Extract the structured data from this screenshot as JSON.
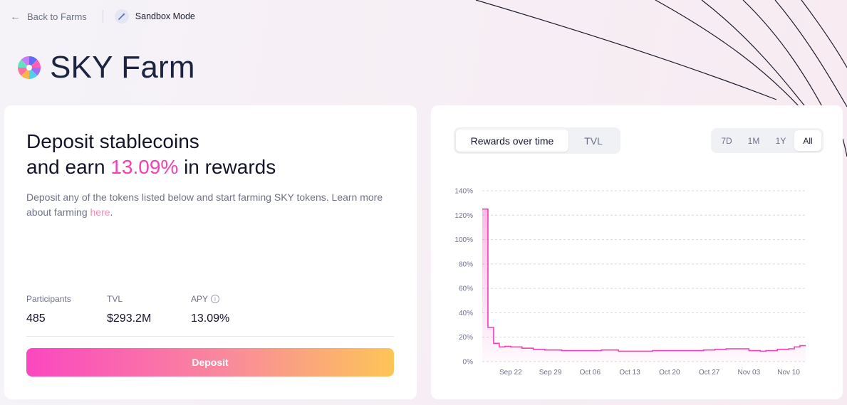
{
  "nav": {
    "back_label": "Back to Farms",
    "sandbox_label": "Sandbox Mode"
  },
  "page": {
    "title": "SKY Farm"
  },
  "hero": {
    "line1": "Deposit stablecoins",
    "line2_prefix": "and earn",
    "line2_rate": "13.09%",
    "line2_suffix": "in rewards",
    "description": "Deposit any of the tokens listed below and start farming SKY tokens. Learn more about farming",
    "link_label": "here"
  },
  "stats": {
    "participants_label": "Participants",
    "participants_value": "485",
    "tvl_label": "TVL",
    "tvl_value": "$293.2M",
    "apy_label": "APY",
    "apy_value": "13.09%"
  },
  "deposit_label": "Deposit",
  "chart_tabs": [
    "Rewards over time",
    "TVL"
  ],
  "active_chart_tab": "Rewards over time",
  "ranges": [
    "7D",
    "1M",
    "1Y",
    "All"
  ],
  "active_range": "All",
  "colors": {
    "accent": "#f53fb4",
    "line": "#f53fb4",
    "grid": "#d8d9e0"
  },
  "chart_data": {
    "type": "area",
    "title": "",
    "xlabel": "",
    "ylabel": "",
    "ylim": [
      0,
      140
    ],
    "y_ticks": [
      "0%",
      "20%",
      "40%",
      "60%",
      "80%",
      "100%",
      "120%",
      "140%"
    ],
    "x_ticks": [
      "Sep 22",
      "Sep 29",
      "Oct 06",
      "Oct 13",
      "Oct 20",
      "Oct 27",
      "Nov 03",
      "Nov 10"
    ],
    "x_range": [
      "Sep 17",
      "Nov 13"
    ],
    "grid": true,
    "series": [
      {
        "step": true,
        "x": [
          "Sep 17",
          "Sep 18",
          "Sep 19",
          "Sep 20",
          "Sep 21",
          "Sep 22",
          "Sep 24",
          "Sep 26",
          "Sep 28",
          "Oct 01",
          "Oct 04",
          "Oct 08",
          "Oct 11",
          "Oct 14",
          "Oct 17",
          "Oct 21",
          "Oct 24",
          "Oct 26",
          "Oct 28",
          "Oct 30",
          "Nov 01",
          "Nov 03",
          "Nov 05",
          "Nov 06",
          "Nov 08",
          "Nov 10",
          "Nov 11",
          "Nov 12",
          "Nov 13"
        ],
        "y": [
          125,
          28,
          15,
          12,
          12.5,
          12,
          11,
          10,
          9.5,
          9,
          9,
          9.5,
          8.5,
          8.5,
          9,
          9,
          9,
          9.5,
          10,
          10.5,
          10.5,
          9,
          8.5,
          9,
          10,
          10.5,
          12,
          13.09,
          13.09
        ]
      }
    ]
  }
}
